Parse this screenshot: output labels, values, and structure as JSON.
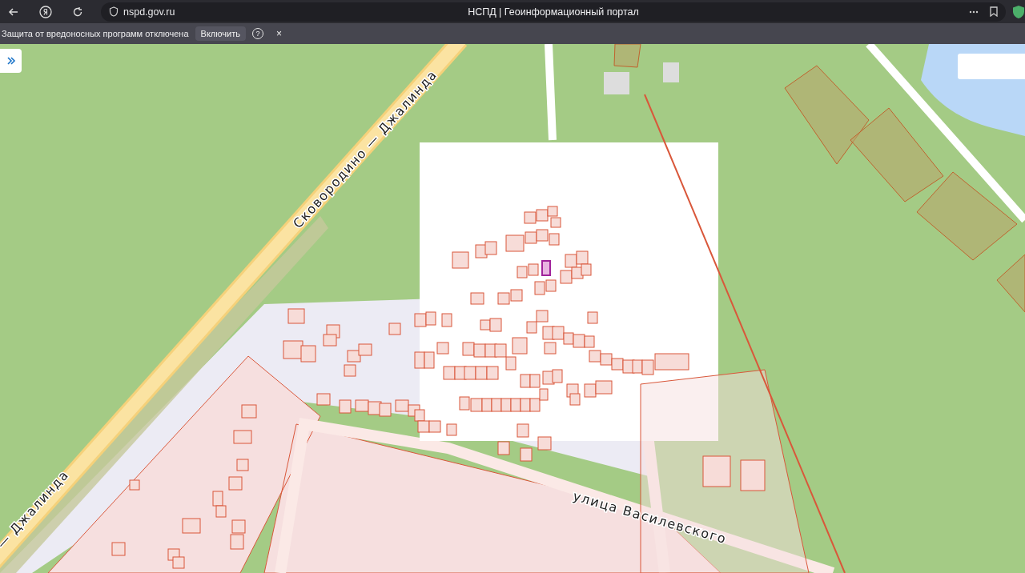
{
  "browser": {
    "url": "nspd.gov.ru",
    "title": "НСПД | Геоинформационный портал"
  },
  "infobar": {
    "message": "Защита от вредоносных программ отключена",
    "button": "Включить",
    "help": "?",
    "close": "×"
  },
  "map": {
    "road_labels": [
      {
        "text": "Сковородино — Джалинда",
        "kind": "highway"
      },
      {
        "text": "— Джалинда",
        "kind": "highway-end"
      },
      {
        "text": "улица Василевского",
        "kind": "street"
      }
    ]
  }
}
